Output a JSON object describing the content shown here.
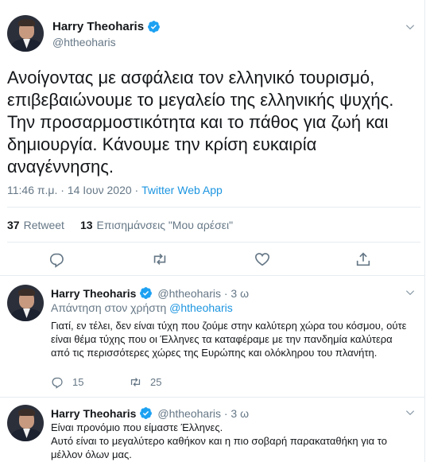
{
  "tweet": {
    "author_name": "Harry Theoharis",
    "author_handle": "@htheoharis",
    "text": "Ανοίγοντας με ασφάλεια τον ελληνικό τουρισμό, επιβεβαιώνουμε το μεγαλείο της ελληνικής ψυχής. Την προσαρμοστικότητα και το πάθος για ζωή και δημιουργία. Κάνουμε την κρίση ευκαιρία αναγέννησης.",
    "timestamp": "11:46 π.μ. · 14 Ιουν 2020 · ",
    "source": "Twitter Web App",
    "retweets_count": "37",
    "retweets_label": "Retweet",
    "likes_count": "13",
    "likes_label": "Επισημάνσεις \"Μου αρέσει\""
  },
  "replies": [
    {
      "author_name": "Harry Theoharis",
      "handle_time": "@htheoharis · 3 ω",
      "reply_to_label": "Απάντηση στον χρήστη ",
      "reply_to_mention": "@htheoharis",
      "text": "Γιατί, εν τέλει, δεν είναι τύχη που ζούμε στην καλύτερη χώρα του κόσμου, ούτε είναι θέμα τύχης που οι Έλληνες τα καταφέραμε με την πανδημία καλύτερα από τις περισσότερες χώρες της Ευρώπης και ολόκληρου του πλανήτη.",
      "replies_count": "15",
      "retweets_count": "25"
    },
    {
      "author_name": "Harry Theoharis",
      "handle_time": "@htheoharis · 3 ω",
      "text_line1": "Είναι προνόμιο που είμαστε Έλληνες.",
      "text_line2": "Αυτό είναι το μεγαλύτερο καθήκον και η πιο σοβαρή παρακαταθήκη για το μέλλον όλων μας."
    }
  ],
  "colors": {
    "accent": "#1b95e0",
    "muted": "#657786",
    "divider": "#e6ecf0",
    "text": "#14171a"
  },
  "icons": [
    "verified-badge-icon",
    "chevron-down-icon",
    "reply-icon",
    "retweet-icon",
    "like-icon",
    "share-icon"
  ]
}
